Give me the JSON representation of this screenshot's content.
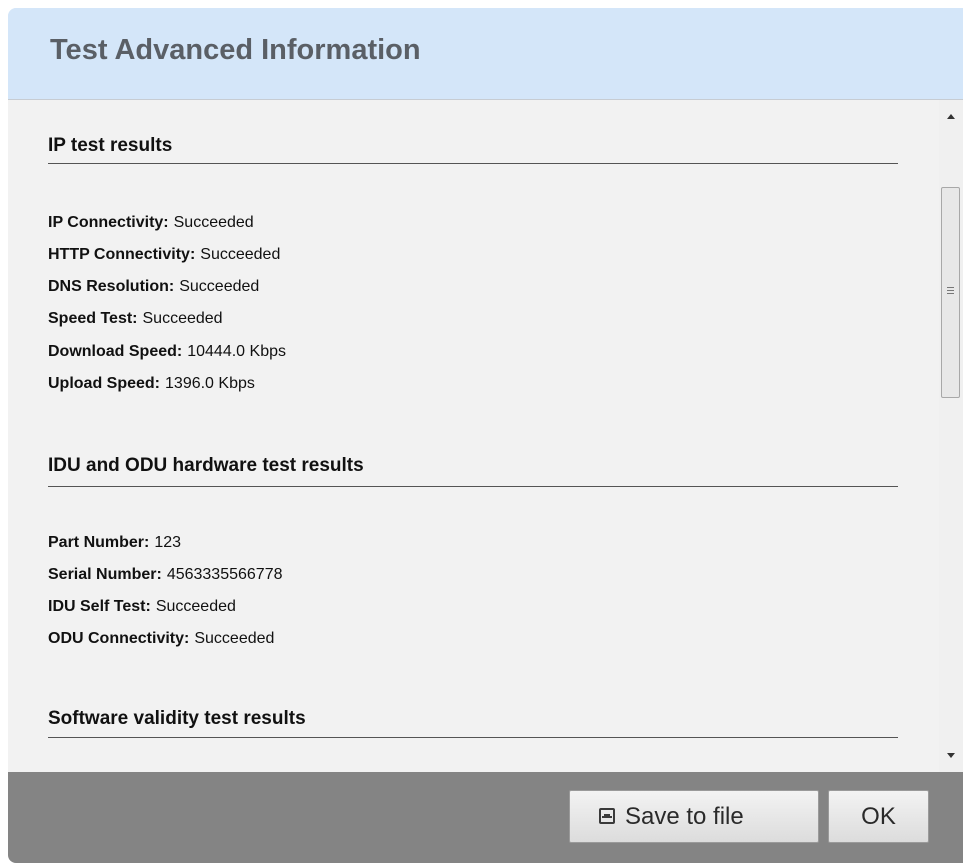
{
  "dialog": {
    "title": "Test Advanced Information"
  },
  "sections": {
    "ip": {
      "title": "IP test results",
      "rows": [
        {
          "label": "IP Connectivity:",
          "value": "Succeeded"
        },
        {
          "label": "HTTP Connectivity:",
          "value": "Succeeded"
        },
        {
          "label": "DNS Resolution:",
          "value": "Succeeded"
        },
        {
          "label": "Speed Test:",
          "value": "Succeeded"
        },
        {
          "label": "Download Speed:",
          "value": "10444.0 Kbps"
        },
        {
          "label": "Upload Speed:",
          "value": "1396.0 Kbps"
        }
      ]
    },
    "hardware": {
      "title": "IDU and ODU hardware test results",
      "rows": [
        {
          "label": "Part Number:",
          "value": "123"
        },
        {
          "label": "Serial Number:",
          "value": "4563335566778"
        },
        {
          "label": "IDU Self Test:",
          "value": "Succeeded"
        },
        {
          "label": "ODU Connectivity:",
          "value": "Succeeded"
        }
      ]
    },
    "software": {
      "title": "Software validity test results"
    }
  },
  "footer": {
    "save_label": "Save to file",
    "save_icon": "save-icon",
    "ok_label": "OK"
  },
  "colors": {
    "header_bg": "#d4e6f9",
    "footer_bg": "#848484",
    "content_bg": "#f2f2f2"
  }
}
